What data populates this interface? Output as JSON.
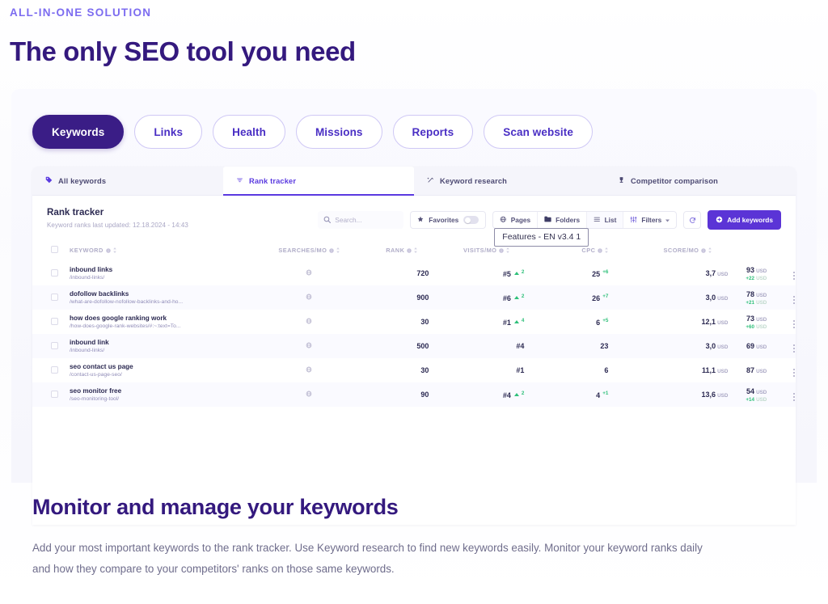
{
  "hero": {
    "eyebrow": "ALL-IN-ONE SOLUTION",
    "title": "The only SEO tool you need"
  },
  "pills": [
    {
      "label": "Keywords",
      "active": true
    },
    {
      "label": "Links",
      "active": false
    },
    {
      "label": "Health",
      "active": false
    },
    {
      "label": "Missions",
      "active": false
    },
    {
      "label": "Reports",
      "active": false
    },
    {
      "label": "Scan website",
      "active": false
    }
  ],
  "tabs": [
    {
      "label": "All keywords",
      "icon": "tag-icon",
      "active": false
    },
    {
      "label": "Rank tracker",
      "icon": "rank-waves-icon",
      "active": true
    },
    {
      "label": "Keyword research",
      "icon": "magic-wand-icon",
      "active": false
    },
    {
      "label": "Competitor comparison",
      "icon": "trophy-icon",
      "active": false
    }
  ],
  "toolbar": {
    "title": "Rank tracker",
    "subtitle": "Keyword ranks last updated: 12.18.2024 - 14:43",
    "search_placeholder": "Search...",
    "favorites_label": "Favorites",
    "pages_label": "Pages",
    "folders_label": "Folders",
    "list_label": "List",
    "filters_label": "Filters",
    "add_keywords_label": "Add keywords",
    "tooltip": "Features - EN v3.4 1"
  },
  "table": {
    "headers": {
      "keyword": "KEYWORD",
      "searches": "SEARCHES/MO",
      "rank": "RANK",
      "visits": "VISITS/MO",
      "cpc": "CPC",
      "score": "SCORE/MO"
    },
    "currency": "USD",
    "rows": [
      {
        "keyword": "inbound links",
        "url": "/inbound-links/",
        "searches": "720",
        "rank": "#5",
        "rank_delta": "2",
        "visits": "25",
        "visits_delta": "+6",
        "cpc": "3,7",
        "score": "93",
        "score_delta": "+22"
      },
      {
        "keyword": "dofollow backlinks",
        "url": "/what-are-dofollow-nofollow-backlinks-and-ho...",
        "searches": "900",
        "rank": "#6",
        "rank_delta": "2",
        "visits": "26",
        "visits_delta": "+7",
        "cpc": "3,0",
        "score": "78",
        "score_delta": "+21"
      },
      {
        "keyword": "how does google ranking work",
        "url": "/how-does-google-rank-websites/#:~:text=To...",
        "searches": "30",
        "rank": "#1",
        "rank_delta": "4",
        "visits": "6",
        "visits_delta": "+5",
        "cpc": "12,1",
        "score": "73",
        "score_delta": "+60"
      },
      {
        "keyword": "inbound link",
        "url": "/inbound-links/",
        "searches": "500",
        "rank": "#4",
        "rank_delta": "",
        "visits": "23",
        "visits_delta": "",
        "cpc": "3,0",
        "score": "69",
        "score_delta": ""
      },
      {
        "keyword": "seo contact us page",
        "url": "/contact-us-page-seo/",
        "searches": "30",
        "rank": "#1",
        "rank_delta": "",
        "visits": "6",
        "visits_delta": "",
        "cpc": "11,1",
        "score": "87",
        "score_delta": ""
      },
      {
        "keyword": "seo monitor free",
        "url": "/seo-monitoring-tool/",
        "searches": "90",
        "rank": "#4",
        "rank_delta": "2",
        "visits": "4",
        "visits_delta": "+1",
        "cpc": "13,6",
        "score": "54",
        "score_delta": "+14"
      }
    ]
  },
  "bottom": {
    "heading": "Monitor and manage your keywords",
    "paragraph": "Add your most important keywords to the rank tracker. Use Keyword research to find new keywords easily. Monitor your keyword ranks daily and how they compare to your competitors' ranks on those same keywords."
  },
  "colors": {
    "brand_dark": "#34197e",
    "brand": "#5b34d6",
    "accent_light": "#7c6cf0",
    "positive": "#2fc07a"
  }
}
